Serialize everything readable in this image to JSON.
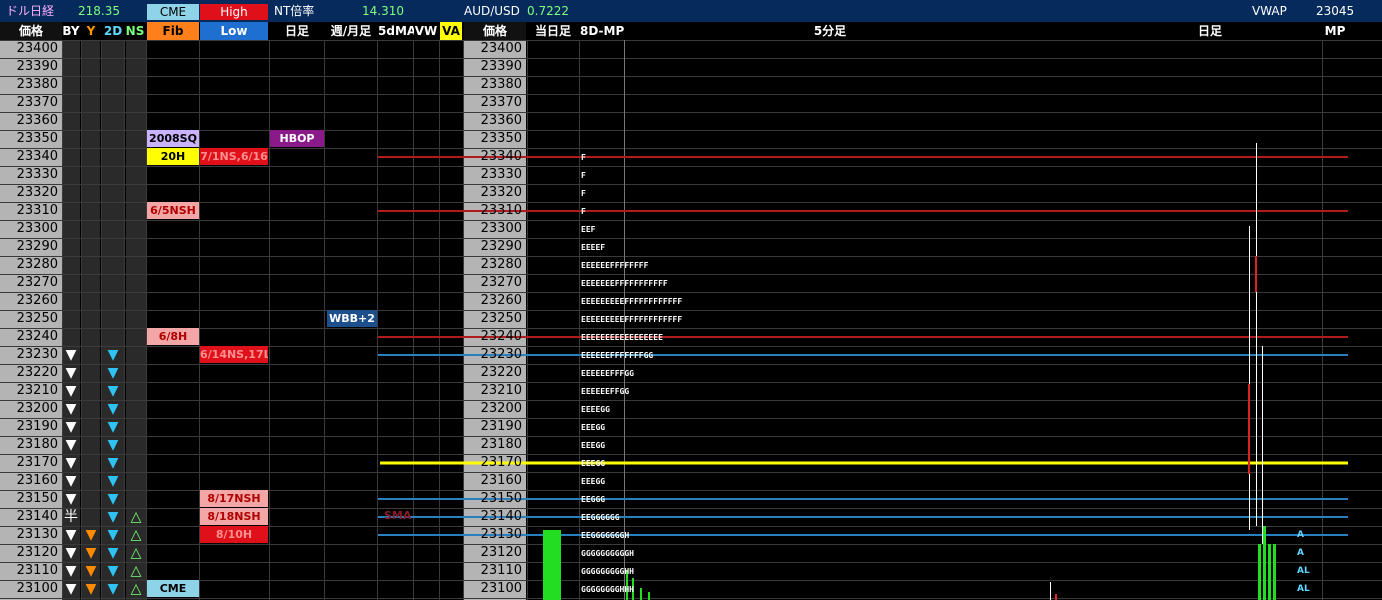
{
  "topbar": {
    "left_label": "ドル日経",
    "left_value": "218.35",
    "cme_tag": "CME",
    "high_tag": "High",
    "nt_label": "NT倍率",
    "nt_value": "14.310",
    "aud_label": "AUD/USD",
    "aud_value": "0.7222",
    "vwap_label": "VWAP",
    "vwap_value": "23045"
  },
  "header": {
    "price": "価格",
    "by": "BY",
    "y": "Y",
    "d2": "2D",
    "ns": "NS",
    "fib": "Fib",
    "low": "Low",
    "daily": "日足",
    "weekly_monthly": "週/月足",
    "ma5d": "5dMA",
    "vw": "VW",
    "va": "VA",
    "price2": "価格",
    "today": "当日足",
    "mp8d": "8D-MP",
    "min5": "5分足",
    "daily2": "日足",
    "mp": "MP"
  },
  "prices": [
    "23400",
    "23390",
    "23380",
    "23370",
    "23360",
    "23350",
    "23340",
    "23330",
    "23320",
    "23310",
    "23300",
    "23290",
    "23280",
    "23270",
    "23260",
    "23250",
    "23240",
    "23230",
    "23220",
    "23210",
    "23200",
    "23190",
    "23180",
    "23170",
    "23160",
    "23150",
    "23140",
    "23130",
    "23120",
    "23110",
    "23100"
  ],
  "level_boxes": [
    {
      "text": "2008SQ",
      "row": 5,
      "col": "fib",
      "bg": "#c9b3ff",
      "fg": "#000"
    },
    {
      "text": "HBOP",
      "row": 5,
      "col": "daily",
      "bg": "#8a1a8a",
      "fg": "#fff"
    },
    {
      "text": "20H",
      "row": 6,
      "col": "fib",
      "bg": "#ffff00",
      "fg": "#000"
    },
    {
      "text": "7/1NS,6/16",
      "row": 6,
      "col": "low",
      "bg": "#e0101a",
      "fg": "#ff9090"
    },
    {
      "text": "6/5NSH",
      "row": 9,
      "col": "fib",
      "bg": "#f3a6a6",
      "fg": "#b00000"
    },
    {
      "text": "WBB+2",
      "row": 15,
      "col": "weekly",
      "bg": "#1d4f8c",
      "fg": "#fff"
    },
    {
      "text": "6/8H",
      "row": 16,
      "col": "fib",
      "bg": "#f3a6a6",
      "fg": "#b00000"
    },
    {
      "text": "6/14NS,17L",
      "row": 17,
      "col": "low",
      "bg": "#e0101a",
      "fg": "#ff9090"
    },
    {
      "text": "8/17NSH",
      "row": 25,
      "col": "low",
      "bg": "#f3a6a6",
      "fg": "#b00000"
    },
    {
      "text": "8/18NSH",
      "row": 26,
      "col": "low",
      "bg": "#f3a6a6",
      "fg": "#b00000"
    },
    {
      "text": "8/10H",
      "row": 27,
      "col": "low",
      "bg": "#e0101a",
      "fg": "#ff9090"
    },
    {
      "text": "CME",
      "row": 30,
      "col": "fib",
      "bg": "#8fd3e8",
      "fg": "#000"
    }
  ],
  "by_marks": [
    {
      "row": 17,
      "t": "▼"
    },
    {
      "row": 18,
      "t": "▼"
    },
    {
      "row": 19,
      "t": "▼"
    },
    {
      "row": 20,
      "t": "▼"
    },
    {
      "row": 21,
      "t": "▼"
    },
    {
      "row": 22,
      "t": "▼"
    },
    {
      "row": 23,
      "t": "▼"
    },
    {
      "row": 24,
      "t": "▼"
    },
    {
      "row": 25,
      "t": "▼"
    },
    {
      "row": 26,
      "t": "半"
    },
    {
      "row": 27,
      "t": "▼"
    },
    {
      "row": 28,
      "t": "▼"
    },
    {
      "row": 29,
      "t": "▼"
    },
    {
      "row": 30,
      "t": "▼"
    }
  ],
  "y_marks": [
    27,
    28,
    29,
    30
  ],
  "d2_marks": [
    17,
    18,
    19,
    20,
    21,
    22,
    23,
    24,
    25,
    26,
    27,
    28,
    29,
    30
  ],
  "ns_marks": [
    26,
    27,
    28,
    29,
    30
  ],
  "sma_label": "SMA",
  "tpo_rows": [
    {
      "row": 6,
      "text": "F"
    },
    {
      "row": 7,
      "text": "F"
    },
    {
      "row": 8,
      "text": "F"
    },
    {
      "row": 9,
      "text": "F"
    },
    {
      "row": 10,
      "text": "EEF"
    },
    {
      "row": 11,
      "text": "EEEEF"
    },
    {
      "row": 12,
      "text": "EEEEEEFFFFFFFF"
    },
    {
      "row": 13,
      "text": "EEEEEEEFFFFFFFFFFF"
    },
    {
      "row": 14,
      "text": "EEEEEEEEEFFFFFFFFFFFF"
    },
    {
      "row": 15,
      "text": "EEEEEEEEEFFFFFFFFFFFF"
    },
    {
      "row": 16,
      "text": "EEEEEEEEEEEEEEEEE"
    },
    {
      "row": 17,
      "text": "EEEEEEFFFFFFFGG"
    },
    {
      "row": 18,
      "text": "EEEEEEFFFGG"
    },
    {
      "row": 19,
      "text": "EEEEEEFFGG"
    },
    {
      "row": 20,
      "text": "EEEEGG"
    },
    {
      "row": 21,
      "text": "EEEGG"
    },
    {
      "row": 22,
      "text": "EEEGG"
    },
    {
      "row": 23,
      "text": "EEEGG"
    },
    {
      "row": 24,
      "text": "EEEGG"
    },
    {
      "row": 25,
      "text": "EEGGG"
    },
    {
      "row": 26,
      "text": "EEGGGGGG"
    },
    {
      "row": 27,
      "text": "EEGGGGGGGH"
    },
    {
      "row": 28,
      "text": "GGGGGGGGGGH"
    },
    {
      "row": 29,
      "text": "GGGGGGGGGHH"
    },
    {
      "row": 30,
      "text": "GGGGGGGGHHH"
    }
  ],
  "mp_letters": [
    {
      "row": 27,
      "text": "A"
    },
    {
      "row": 28,
      "text": "A"
    },
    {
      "row": 29,
      "text": "AL"
    },
    {
      "row": 30,
      "text": "AL"
    }
  ],
  "colors": {
    "red_line": "#b01c1c",
    "blue_line": "#2a7fbf",
    "yellow_line": "#ffff00",
    "green_bar": "#22dd22"
  }
}
